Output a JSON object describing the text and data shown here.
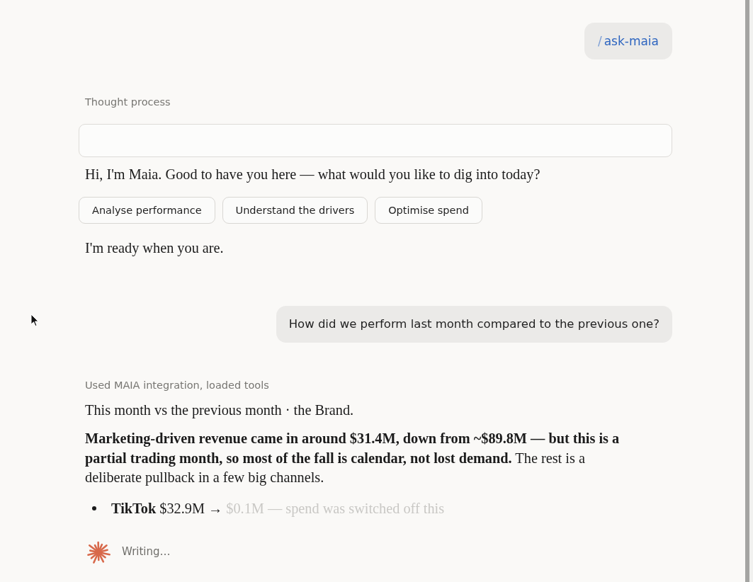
{
  "command_message": {
    "prefix": "/",
    "command": "ask-maia"
  },
  "thought_process": {
    "label": "Thought process"
  },
  "assistant_intro": {
    "greeting": "Hi, I'm Maia. Good to have you here — what would you like to dig into today?",
    "suggestions": [
      "Analyse performance",
      "Understand the drivers",
      "Optimise spend"
    ],
    "closing": "I'm ready when you are."
  },
  "user_message": {
    "text": "How did we perform last month compared to the previous one?"
  },
  "assistant_reply": {
    "tool_status": "Used MAIA integration, loaded tools",
    "subtitle": "This month vs the previous month · the Brand.",
    "summary": "**Marketing-driven revenue came in around $31.4M, down from ~$89.8M — but this is a partial trading month, so most of the fall is calendar, not lost demand.** The rest is a deliberate pullback in a few big channels.",
    "bullets": [
      {
        "text": "**TikTok** $32.9M →",
        "pending_text": "$0.1M — spend was switched off this"
      }
    ]
  },
  "status": {
    "text": "Writing…"
  }
}
